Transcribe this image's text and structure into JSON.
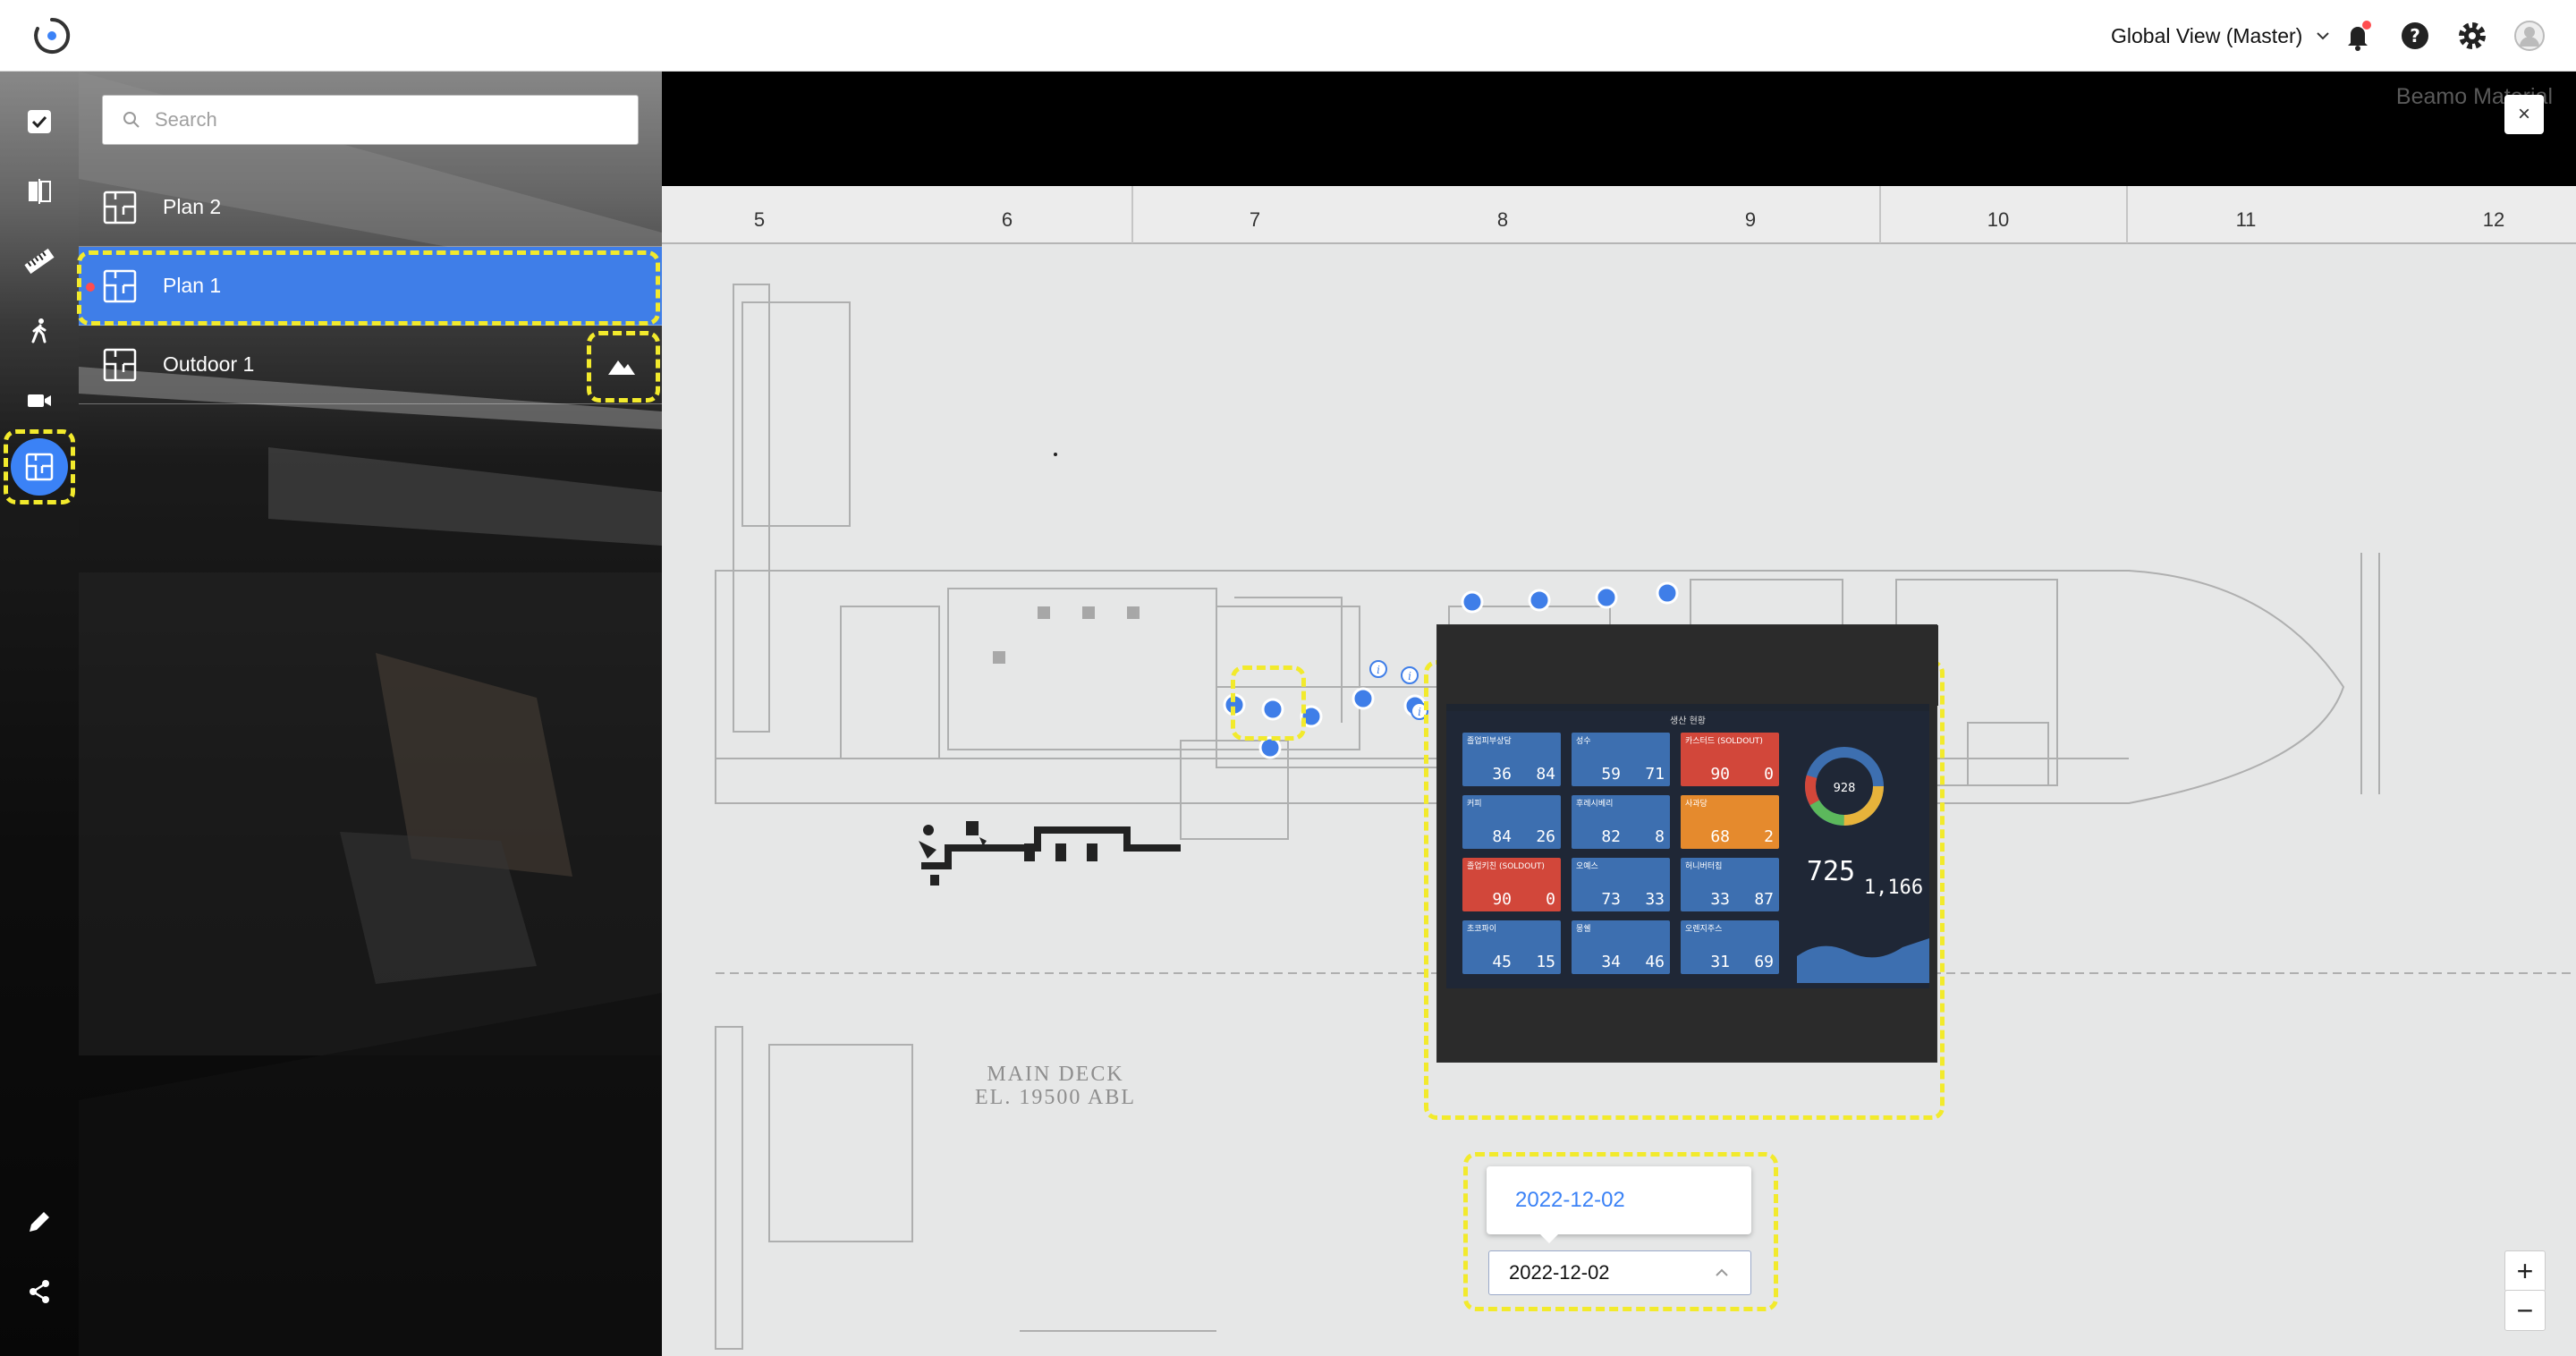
{
  "header": {
    "view_selector": "Global View (Master)",
    "icons": [
      "logo-icon",
      "chevron-down-icon",
      "bell-icon",
      "help-icon",
      "gear-icon",
      "user-avatar-icon"
    ]
  },
  "sidebar": {
    "tools": [
      "check-shield-icon",
      "compare-icon",
      "ruler-icon",
      "walk-icon",
      "video-icon",
      "floor-plan-icon",
      "pencil-icon",
      "share-icon"
    ],
    "active_tool": "floor-plan-icon"
  },
  "plans_panel": {
    "search_placeholder": "Search",
    "plans": [
      {
        "label": "Plan 2",
        "active": false
      },
      {
        "label": "Plan 1",
        "active": true
      },
      {
        "label": "Outdoor 1",
        "active": false
      }
    ]
  },
  "viewer": {
    "room_label": "Beamo Material",
    "close_label": "×",
    "ruler": [
      "5",
      "6",
      "7",
      "8",
      "9",
      "10",
      "11",
      "12"
    ],
    "plan_text": [
      "MAIN DECK",
      "EL. 19500 ABL"
    ],
    "date_tooltip": "2022-12-02",
    "date_value": "2022-12-02",
    "zoom_in": "+",
    "zoom_out": "−",
    "dashboard": {
      "title": "생산 현황",
      "tiles": [
        {
          "name": "졸업피부상담",
          "a": "36",
          "b": "84",
          "color": "#3d6fb0"
        },
        {
          "name": "성수",
          "a": "59",
          "b": "71",
          "color": "#3d6fb0"
        },
        {
          "name": "카스터드 (SOLDOUT)",
          "a": "90",
          "b": "0",
          "color": "#d2473a"
        },
        {
          "name": "커피",
          "a": "84",
          "b": "26",
          "color": "#3d6fb0"
        },
        {
          "name": "후레시베리",
          "a": "82",
          "b": "8",
          "color": "#3d6fb0"
        },
        {
          "name": "사과당",
          "a": "68",
          "b": "2",
          "color": "#e58a2d"
        },
        {
          "name": "졸업키친 (SOLDOUT)",
          "a": "90",
          "b": "0",
          "color": "#d2473a"
        },
        {
          "name": "오예스",
          "a": "73",
          "b": "33",
          "color": "#3d6fb0"
        },
        {
          "name": "허니버터칩",
          "a": "33",
          "b": "87",
          "color": "#3d6fb0"
        },
        {
          "name": "초코파이",
          "a": "45",
          "b": "15",
          "color": "#3d6fb0"
        },
        {
          "name": "몽쉘",
          "a": "34",
          "b": "46",
          "color": "#3d6fb0"
        },
        {
          "name": "오렌지주스",
          "a": "31",
          "b": "69",
          "color": "#3d6fb0"
        }
      ],
      "donut_value": "928",
      "big_left": "725",
      "big_right": "1,166"
    }
  }
}
